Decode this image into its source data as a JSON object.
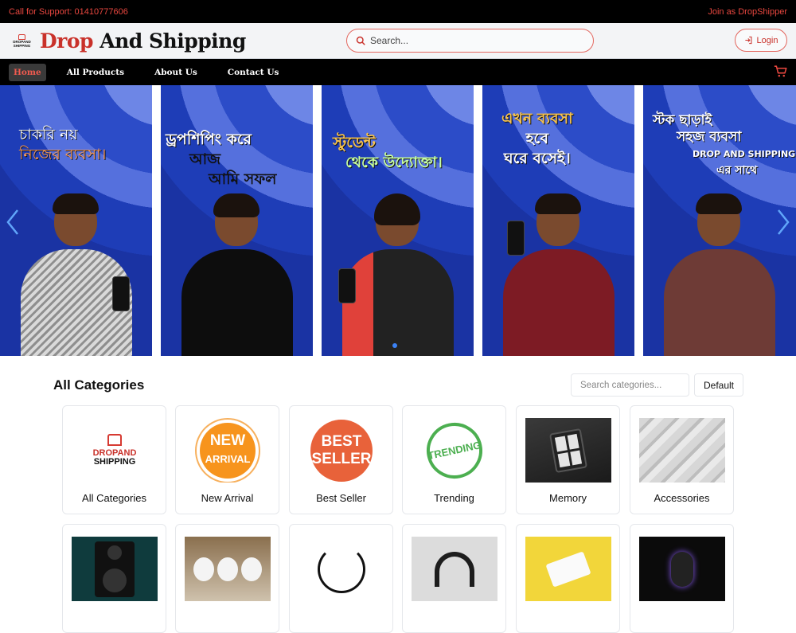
{
  "topbar": {
    "support": "Call for Support: 01410777606",
    "join": "Join as DropShipper"
  },
  "header": {
    "logo_text": "DROPAND SHIPPING",
    "brand_part1": "Drop",
    "brand_part2": "And Shipping",
    "search_placeholder": "Search...",
    "login_label": "Login"
  },
  "nav": {
    "items": [
      "Home",
      "All Products",
      "About Us",
      "Contact Us"
    ],
    "active": "Home"
  },
  "slider": {
    "slides": [
      {
        "line1": "চাকরি নয়",
        "line2": "নিজের ব্যবসা।"
      },
      {
        "line1": "ড্রপশিপিং করে",
        "line2": "আজ",
        "line3": "আমি সফল"
      },
      {
        "line1": "স্টুডেন্ট",
        "line2": "থেকে উদ্যোক্তা।"
      },
      {
        "line1": "এখন ব্যবসা",
        "line2": "হবে",
        "line3": "ঘরে বসেই।"
      },
      {
        "line1": "স্টক ছাড়াই",
        "line2": "সহজ ব্যবসা",
        "line3": "DROP AND SHIPPING",
        "line4": "এর সাথে"
      }
    ]
  },
  "categories": {
    "title": "All Categories",
    "search_placeholder": "Search categories...",
    "sort_label": "Default",
    "items": [
      {
        "label": "All Categories",
        "logo_line1": "DROPAND",
        "logo_line2": "SHIPPING"
      },
      {
        "label": "New Arrival",
        "stamp_line1": "NEW",
        "stamp_line2": "ARRIVAL"
      },
      {
        "label": "Best Seller",
        "stamp_line1": "BEST",
        "stamp_line2": "SELLER"
      },
      {
        "label": "Trending",
        "stamp_line1": "TRENDING"
      },
      {
        "label": "Memory"
      },
      {
        "label": "Accessories"
      }
    ]
  },
  "colors": {
    "accent": "#c9312a",
    "nav_active": "#ef5a4f",
    "slide_blue": "#1e3db7"
  }
}
